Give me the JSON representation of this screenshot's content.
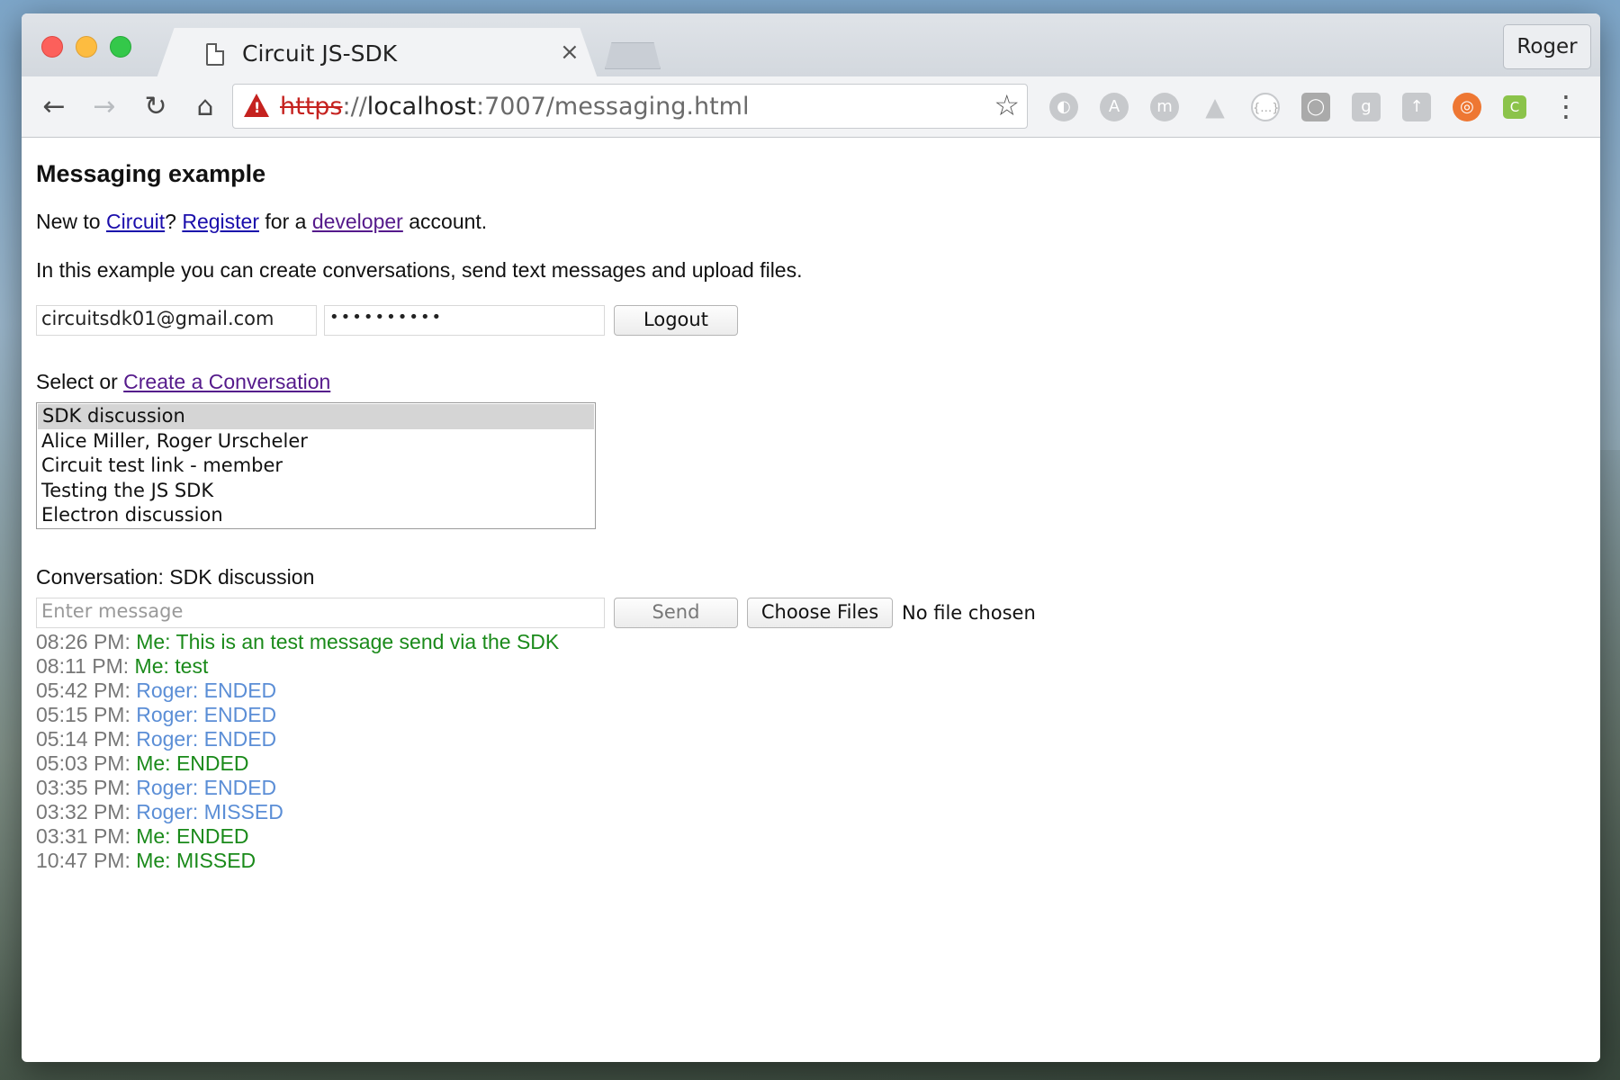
{
  "browser": {
    "tab_title": "Circuit JS-SDK",
    "tab_close": "×",
    "profile_name": "Roger",
    "url_scheme": "https",
    "url_sep": "://",
    "url_host": "localhost",
    "url_rest": ":7007/messaging.html",
    "nav": {
      "back": "←",
      "forward": "→",
      "reload": "↻",
      "home": "⌂"
    },
    "extensions": [
      "extension-icon",
      "angular-icon",
      "m-icon",
      "drive-icon",
      "braces-icon",
      "box-icon",
      "google-icon",
      "translate-icon",
      "lifebuoy-icon",
      "c-icon"
    ],
    "menu": "⋮"
  },
  "page": {
    "heading": "Messaging example",
    "intro": {
      "t1": "New to ",
      "circuit_link": "Circuit",
      "t2": "? ",
      "register_link": "Register",
      "t3": " for a ",
      "developer_link": "developer",
      "t4": " account."
    },
    "description": "In this example you can create conversations, send text messages and upload files.",
    "login": {
      "email_value": "circuitsdk01@gmail.com",
      "password_value": "••••••••••",
      "logout_label": "Logout"
    },
    "select": {
      "prefix": "Select or ",
      "create_link": "Create a Conversation",
      "conversations": [
        "SDK discussion",
        "Alice Miller, Roger Urscheler",
        "Circuit test link - member",
        "Testing the JS SDK",
        "Electron discussion"
      ],
      "selected_index": 0
    },
    "conversation": {
      "title": "Conversation: SDK discussion",
      "message_placeholder": "Enter message",
      "send_label": "Send",
      "choose_files_label": "Choose Files",
      "no_file_text": "No file chosen"
    },
    "messages": [
      {
        "time": "08:26 PM: ",
        "text": "Me: This is an test message send via the SDK",
        "from_me": true
      },
      {
        "time": "08:11 PM: ",
        "text": "Me: test",
        "from_me": true
      },
      {
        "time": "05:42 PM: ",
        "text": "Roger: ENDED",
        "from_me": false
      },
      {
        "time": "05:15 PM: ",
        "text": "Roger: ENDED",
        "from_me": false
      },
      {
        "time": "05:14 PM: ",
        "text": "Roger: ENDED",
        "from_me": false
      },
      {
        "time": "05:03 PM: ",
        "text": "Me: ENDED",
        "from_me": true
      },
      {
        "time": "03:35 PM: ",
        "text": "Roger: ENDED",
        "from_me": false
      },
      {
        "time": "03:32 PM: ",
        "text": "Roger: MISSED",
        "from_me": false
      },
      {
        "time": "03:31 PM: ",
        "text": "Me: ENDED",
        "from_me": true
      },
      {
        "time": "10:47 PM: ",
        "text": "Me: MISSED",
        "from_me": true
      }
    ],
    "colors": {
      "me": "#1a8a1a",
      "other": "#5b8ed6",
      "time": "#777777",
      "link": "#1a0dab"
    }
  }
}
